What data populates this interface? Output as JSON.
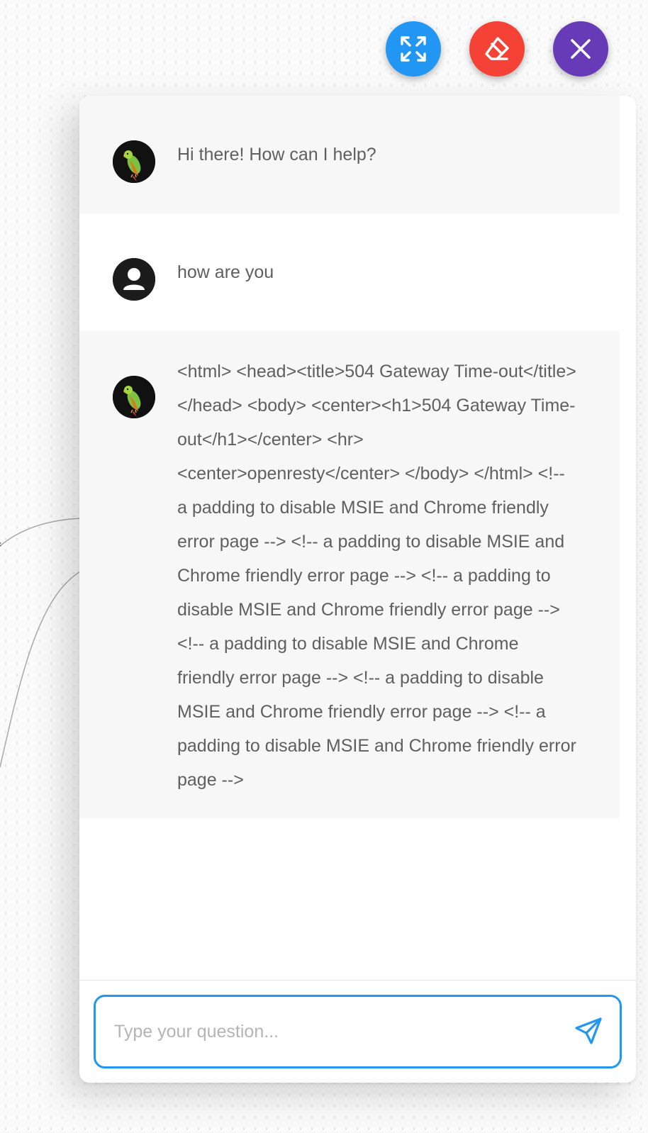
{
  "colors": {
    "expand_button": "#2196f3",
    "clear_button": "#f44336",
    "close_button": "#673ab7",
    "input_border": "#2196f3",
    "send_icon": "#2196f3"
  },
  "toolbar": {
    "expand_icon": "expand-arrows-icon",
    "clear_icon": "eraser-icon",
    "close_icon": "close-icon"
  },
  "messages": [
    {
      "role": "bot",
      "avatar_icon": "parrot-avatar-icon",
      "text": "Hi there! How can I help?"
    },
    {
      "role": "user",
      "avatar_icon": "user-avatar-icon",
      "text": "how are you"
    },
    {
      "role": "bot",
      "avatar_icon": "parrot-avatar-icon",
      "text": "<html> <head><title>504 Gateway Time-out</title></head> <body> <center><h1>504 Gateway Time-out</h1></center> <hr> <center>openresty</center> </body> </html> <!-- a padding to disable MSIE and Chrome friendly error page --> <!-- a padding to disable MSIE and Chrome friendly error page --> <!-- a padding to disable MSIE and Chrome friendly error page --> <!-- a padding to disable MSIE and Chrome friendly error page --> <!-- a padding to disable MSIE and Chrome friendly error page --> <!-- a padding to disable MSIE and Chrome friendly error page -->"
    }
  ],
  "input": {
    "value": "",
    "placeholder": "Type your question...",
    "send_icon": "send-icon"
  }
}
